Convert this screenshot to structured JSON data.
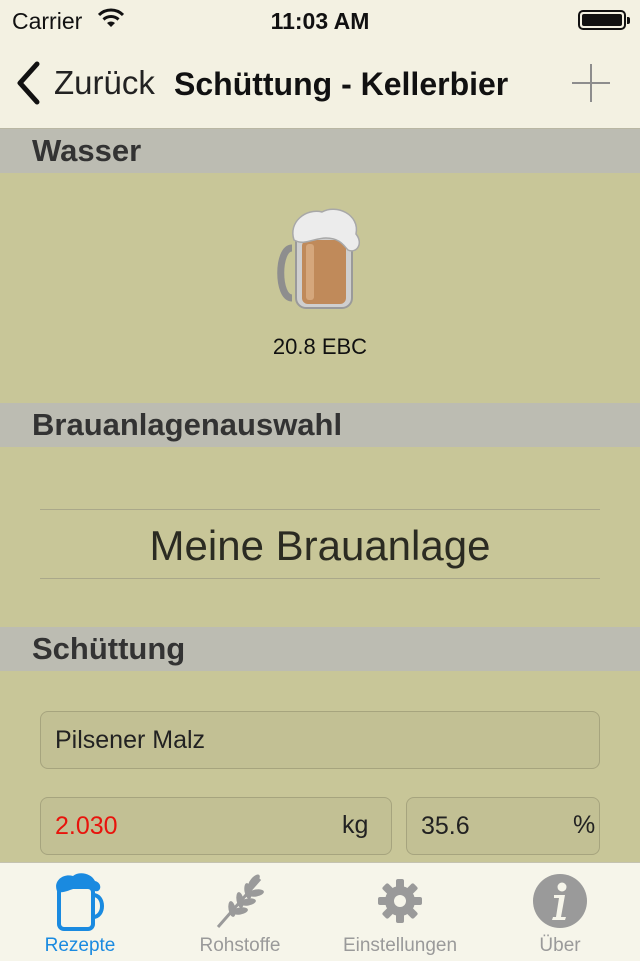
{
  "status_bar": {
    "carrier": "Carrier",
    "time": "11:03 AM"
  },
  "nav": {
    "back_label": "Zurück",
    "title": "Schüttung - Kellerbier"
  },
  "sections": {
    "water": "Wasser",
    "brewery": "Brauanlagenauswahl",
    "grist": "Schüttung"
  },
  "water": {
    "color_label": "20.8 EBC"
  },
  "brewery": {
    "selected": "Meine Brauanlage"
  },
  "grist": {
    "malt_name": "Pilsener Malz",
    "amount": "2.030",
    "amount_unit": "kg",
    "percent": "35.6",
    "percent_unit": "%"
  },
  "tabs": [
    {
      "label": "Rezepte",
      "icon": "beer-mug-icon",
      "active": true
    },
    {
      "label": "Rohstoffe",
      "icon": "wheat-icon",
      "active": false
    },
    {
      "label": "Einstellungen",
      "icon": "gear-icon",
      "active": false
    },
    {
      "label": "Über",
      "icon": "info-icon",
      "active": false
    }
  ],
  "colors": {
    "background": "#c8c698",
    "section_header": "#bcbcb2",
    "tab_active": "#1a8ae0",
    "amount_text": "#e8140c"
  }
}
